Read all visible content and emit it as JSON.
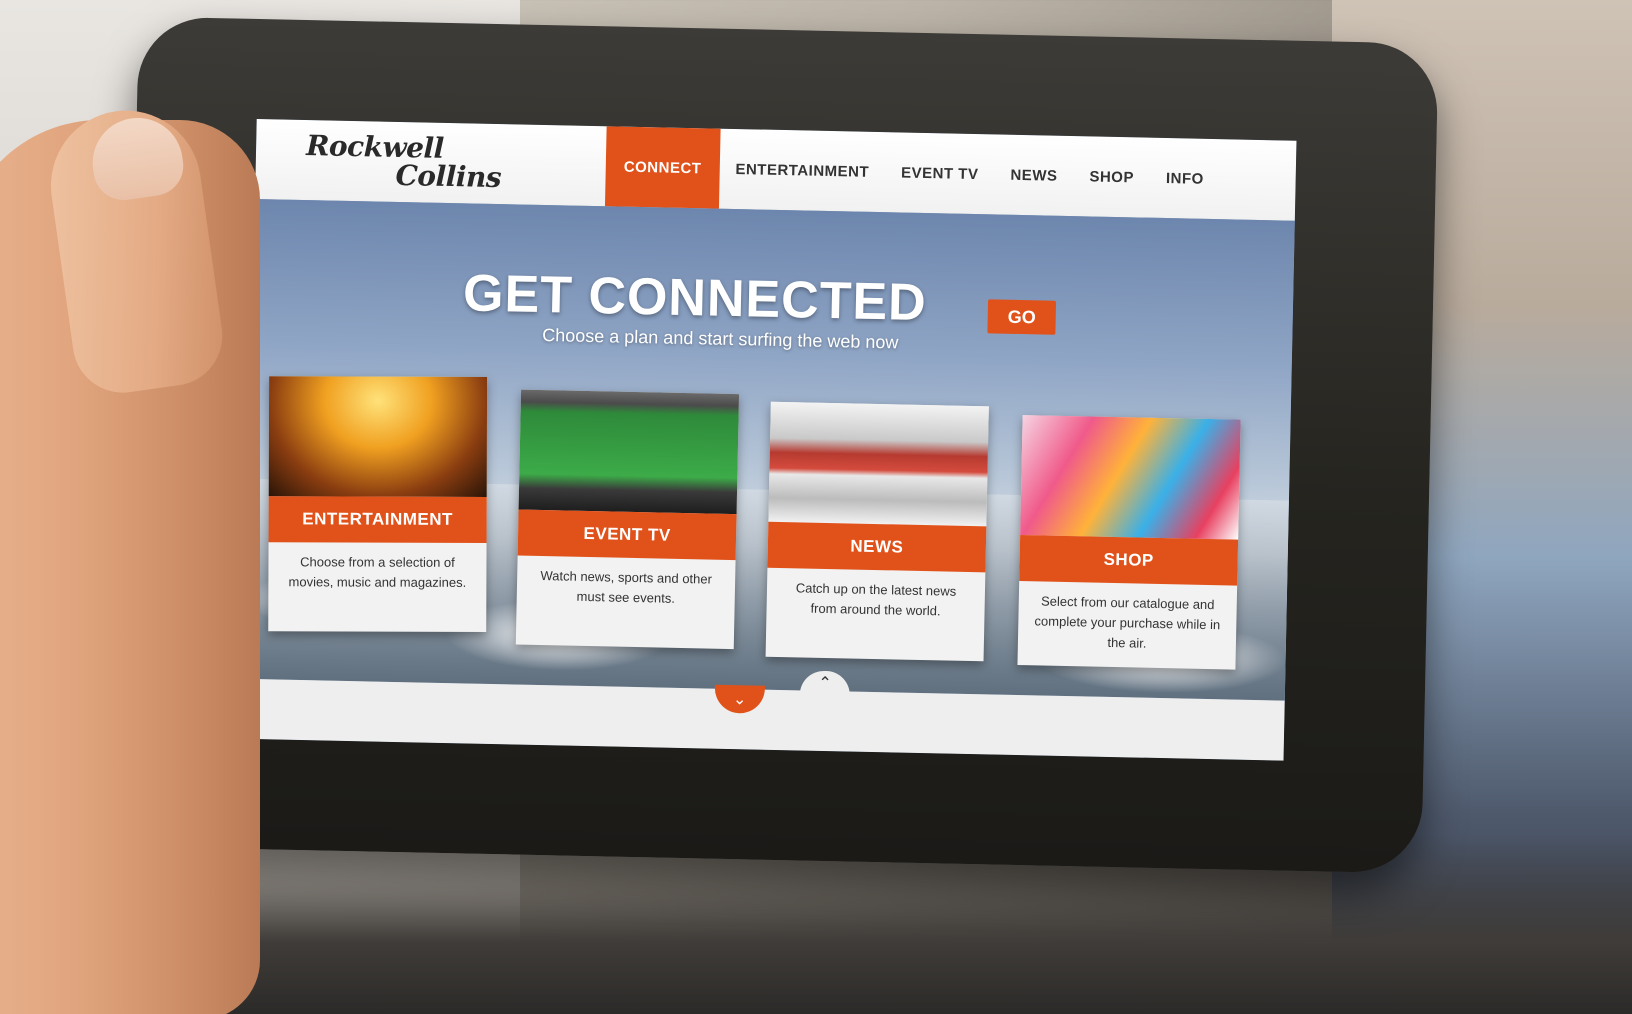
{
  "logo": {
    "line1": "Rockwell",
    "line2": "Collins"
  },
  "nav": {
    "items": [
      {
        "label": "CONNECT",
        "active": true
      },
      {
        "label": "ENTERTAINMENT",
        "active": false
      },
      {
        "label": "EVENT TV",
        "active": false
      },
      {
        "label": "NEWS",
        "active": false
      },
      {
        "label": "SHOP",
        "active": false
      },
      {
        "label": "INFO",
        "active": false
      }
    ]
  },
  "hero": {
    "title": "GET CONNECTED",
    "subtitle": "Choose a plan and start surfing the web now",
    "go_label": "GO"
  },
  "cards": [
    {
      "title": "ENTERTAINMENT",
      "description": "Choose from a selection of movies, music and magazines."
    },
    {
      "title": "EVENT TV",
      "description": "Watch news, sports and other must see events."
    },
    {
      "title": "NEWS",
      "description": "Catch up on the latest news from around the world."
    },
    {
      "title": "SHOP",
      "description": "Select from our catalogue and complete your purchase while in the air."
    }
  ],
  "controls": {
    "down_icon": "chevron-down-icon",
    "up_icon": "chevron-up-icon",
    "down_glyph": "⌄",
    "up_glyph": "⌃"
  },
  "colors": {
    "accent": "#e1521b",
    "header_bg": "#ffffff",
    "card_bg": "#f2f2f2"
  }
}
